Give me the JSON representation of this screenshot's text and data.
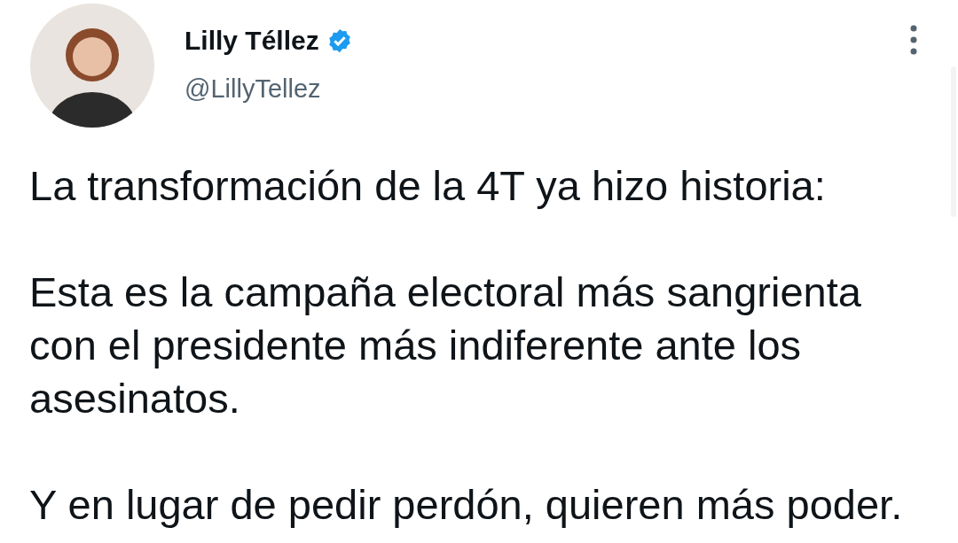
{
  "author": {
    "name": "Lilly Téllez",
    "verified": true,
    "handle": "@LillyTellez"
  },
  "paragraphs": [
    "La transformación de la 4T ya hizo historia:",
    "Esta es la campaña electoral más sangrienta con el presidente más indiferente ante los asesinatos.",
    "Y en lugar de pedir perdón, quieren más poder."
  ]
}
